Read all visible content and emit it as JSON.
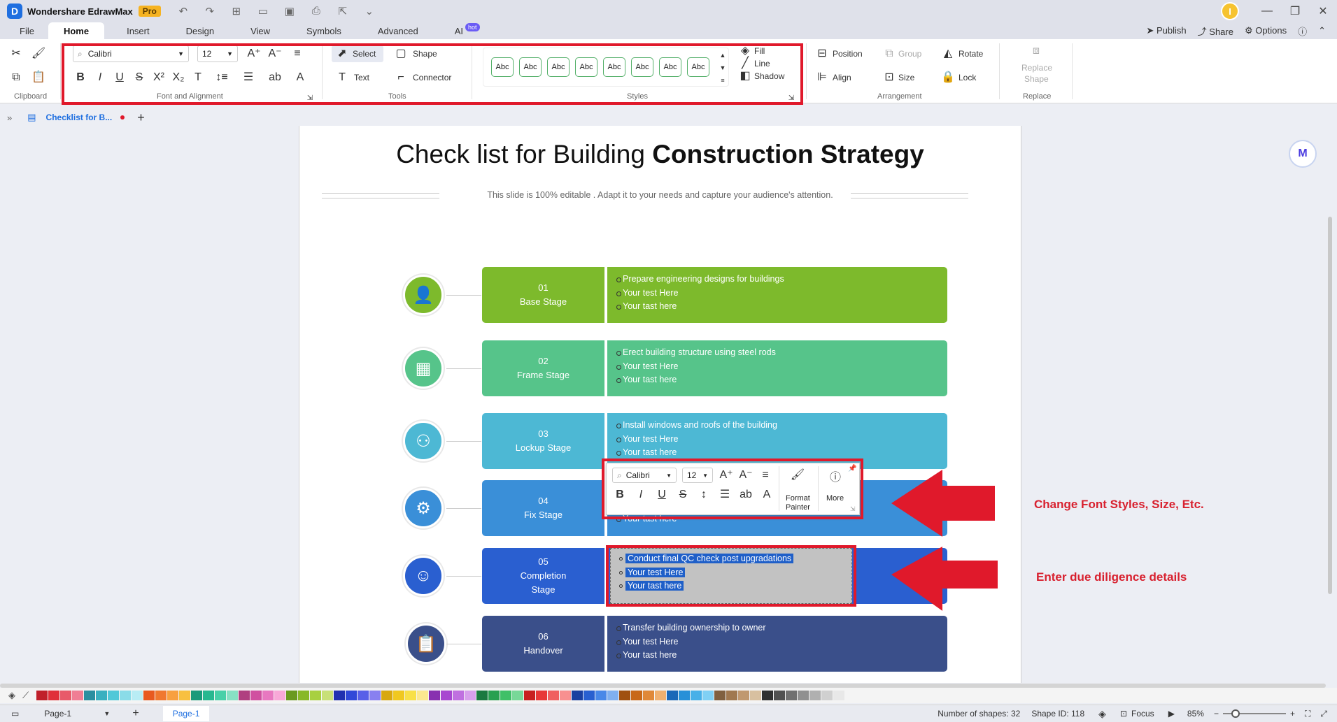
{
  "app": {
    "name": "Wondershare EdrawMax",
    "badge": "Pro",
    "user_initial": "I"
  },
  "menu": {
    "tabs": [
      "File",
      "Home",
      "Insert",
      "Design",
      "View",
      "Symbols",
      "Advanced",
      "AI"
    ],
    "ai_badge": "hot",
    "right": {
      "publish": "Publish",
      "share": "Share",
      "options": "Options"
    }
  },
  "ribbon": {
    "clipboard_label": "Clipboard",
    "font_family": "Calibri",
    "font_size": "12",
    "font_group_label": "Font and Alignment",
    "select_label": "Select",
    "shape_label": "Shape",
    "text_label": "Text",
    "connector_label": "Connector",
    "tools_label": "Tools",
    "style_sample": "Abc",
    "styles_label": "Styles",
    "fill_label": "Fill",
    "line_label": "Line",
    "shadow_label": "Shadow",
    "position_label": "Position",
    "group_label": "Group",
    "rotate_label": "Rotate",
    "align_label": "Align",
    "size_label": "Size",
    "lock_label": "Lock",
    "arrangement_label": "Arrangement",
    "replace_shape_label_1": "Replace",
    "replace_shape_label_2": "Shape",
    "replace_label": "Replace"
  },
  "doc_tab": {
    "title": "Checklist for B..."
  },
  "slide": {
    "title_regular": "Check list for Building ",
    "title_bold": "Construction Strategy",
    "subtitle": "This slide is 100% editable . Adapt it to your needs and capture your audience's attention.",
    "stages": [
      {
        "num": "01",
        "name": "Base Stage",
        "bullets": [
          "Prepare engineering designs for buildings",
          "Your test Here",
          "Your tast here"
        ]
      },
      {
        "num": "02",
        "name": "Frame Stage",
        "bullets": [
          "Erect building structure using steel rods",
          "Your test Here",
          "Your tast here"
        ]
      },
      {
        "num": "03",
        "name": "Lockup Stage",
        "bullets": [
          "Install windows and roofs of the building",
          "Your test Here",
          "Your tast here"
        ]
      },
      {
        "num": "04",
        "name": "Fix Stage",
        "bullets": [
          "Your tast here"
        ]
      },
      {
        "num": "05",
        "name": "Completion",
        "name2": "Stage",
        "bullets": [
          "Conduct final QC check post upgradations",
          "Your test Here",
          "Your tast here"
        ]
      },
      {
        "num": "06",
        "name": "Handover",
        "bullets": [
          "Transfer building ownership to owner",
          "Your test Here",
          "Your tast here"
        ]
      }
    ],
    "colors": {
      "s1": "#7dba2c",
      "s2": "#56c48a",
      "s3": "#4db8d4",
      "s4": "#3a8fd8",
      "s5": "#2a5fd0",
      "s6": "#3a4f8a"
    }
  },
  "mini_toolbar": {
    "font_family": "Calibri",
    "font_size": "12",
    "format_painter_1": "Format",
    "format_painter_2": "Painter",
    "more": "More"
  },
  "annotations": {
    "font": "Change Font Styles, Size, Etc.",
    "diligence": "Enter due diligence details"
  },
  "status": {
    "page_select": "Page-1",
    "page_tab": "Page-1",
    "shapes": "Number of shapes: 32",
    "shape_id": "Shape ID: 118",
    "focus": "Focus",
    "zoom": "85%"
  },
  "palette_colors": [
    "#c0202a",
    "#e0303a",
    "#e85a6a",
    "#f07e94",
    "#2a8fa0",
    "#3ab0c0",
    "#50c8d8",
    "#8adce8",
    "#b8ecf4",
    "#e85a20",
    "#f07830",
    "#f8a040",
    "#f8c040",
    "#1a9a7a",
    "#28b890",
    "#48d0a8",
    "#88e0c4",
    "#b04080",
    "#d050a0",
    "#e878c0",
    "#f8a8d8",
    "#6a9a20",
    "#88b828",
    "#a8d040",
    "#c8e078",
    "#2030b0",
    "#3048d8",
    "#5860e8",
    "#8880f0",
    "#d8a810",
    "#f0c820",
    "#f8e048",
    "#fce890",
    "#8830b0",
    "#a848d0",
    "#c070e0",
    "#d8a0ec",
    "#1a7a40",
    "#28a050",
    "#40c068",
    "#78d898",
    "#c82020",
    "#e83838",
    "#f06060",
    "#f89090",
    "#1a40a0",
    "#2860d0",
    "#4888e8",
    "#80b0f0",
    "#a05010",
    "#c86818",
    "#e08838",
    "#f0b070",
    "#1a68b8",
    "#2890d8",
    "#48b0e8",
    "#80d0f4",
    "#806040",
    "#a07850",
    "#c09870",
    "#d8c0a0",
    "#303030",
    "#505050",
    "#707070",
    "#909090",
    "#b0b0b0",
    "#d0d0d0",
    "#e8e8e8"
  ]
}
